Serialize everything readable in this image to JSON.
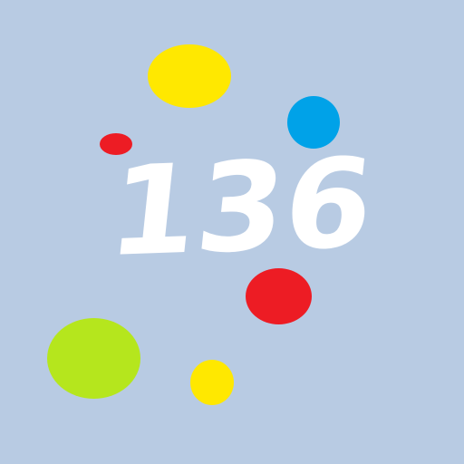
{
  "display": {
    "value": "136"
  },
  "colors": {
    "background": "#b8cbe3",
    "number": "#ffffff",
    "dot_yellow": "#ffe800",
    "dot_blue": "#00a2e8",
    "dot_red": "#ed1c24",
    "dot_green": "#b5e61d"
  },
  "dots": [
    {
      "color_name": "yellow",
      "color": "#ffe800"
    },
    {
      "color_name": "blue",
      "color": "#00a2e8"
    },
    {
      "color_name": "red",
      "color": "#ed1c24"
    },
    {
      "color_name": "red",
      "color": "#ed1c24"
    },
    {
      "color_name": "green",
      "color": "#b5e61d"
    },
    {
      "color_name": "yellow",
      "color": "#ffe800"
    }
  ]
}
